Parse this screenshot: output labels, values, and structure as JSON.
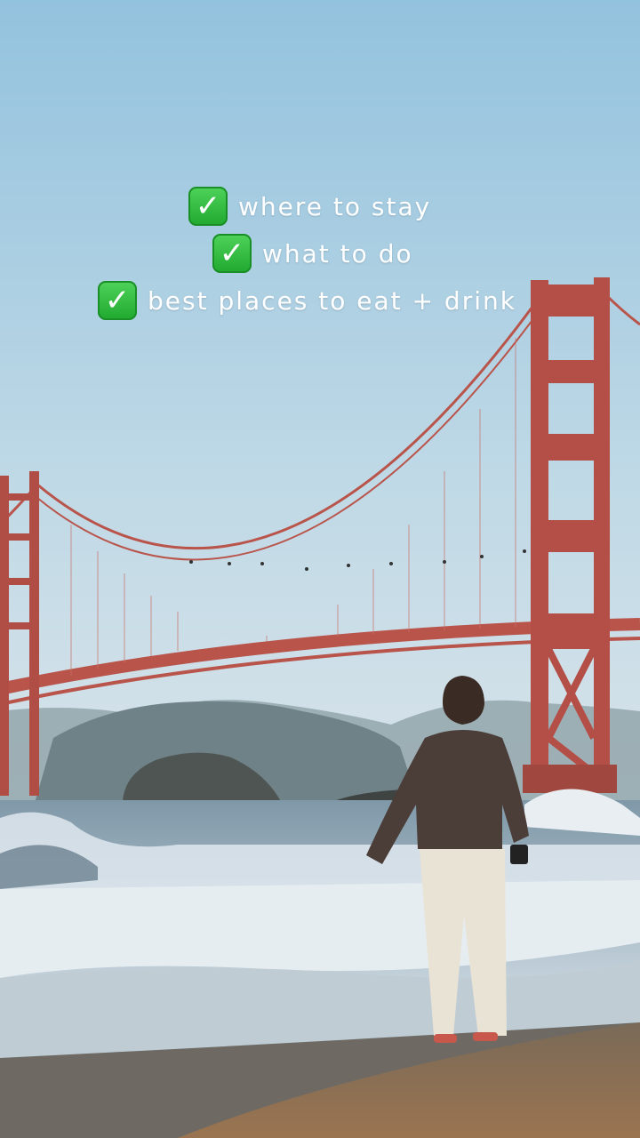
{
  "overlay": {
    "items": [
      {
        "icon": "check-mark-icon",
        "text": "where to stay"
      },
      {
        "icon": "check-mark-icon",
        "text": "what to do"
      },
      {
        "icon": "check-mark-icon",
        "text": "best places to eat + drink"
      }
    ],
    "colors": {
      "check_bg": "#2fbf3c",
      "text": "#ffffff",
      "bridge": "#c0554b",
      "sky_top": "#9ec8e0",
      "sand": "#8a6a48"
    }
  },
  "scene": {
    "elements": [
      "sky",
      "golden-gate-bridge",
      "hills",
      "rock",
      "ocean-waves",
      "beach",
      "person-standing"
    ]
  }
}
